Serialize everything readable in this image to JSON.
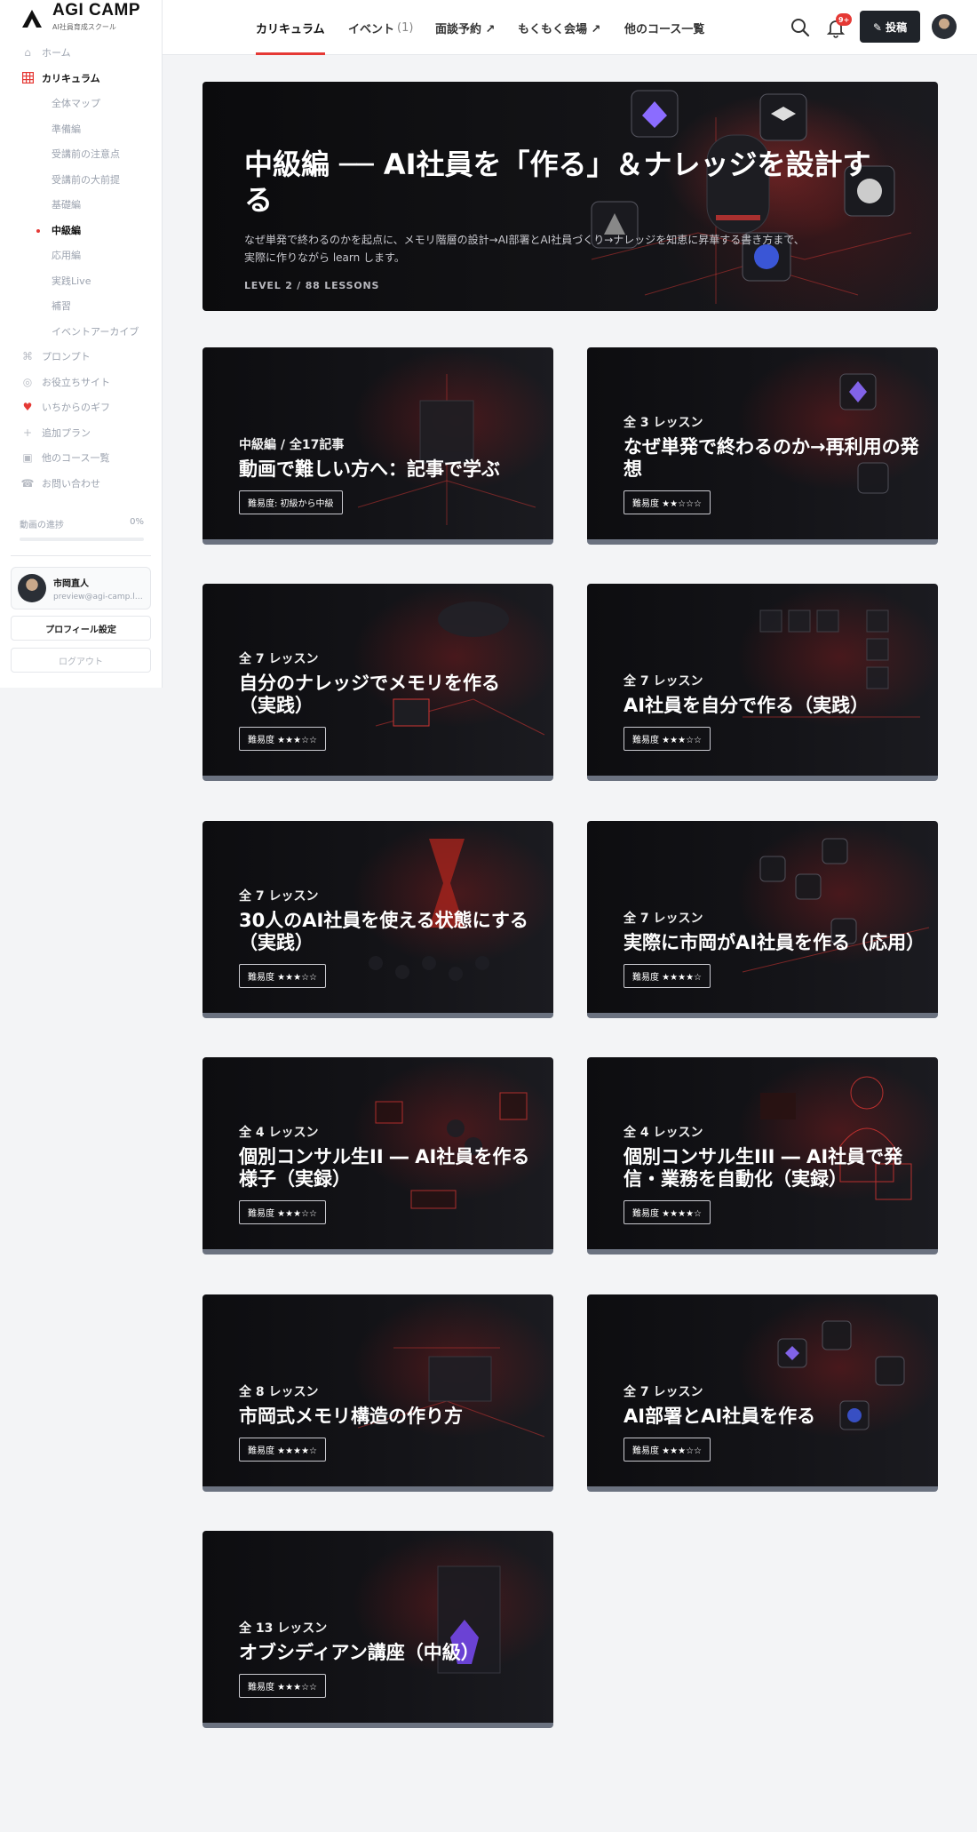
{
  "brand": {
    "title": "AGI CAMP",
    "subtitle": "AI社員育成スクール"
  },
  "sidebar": {
    "items": [
      {
        "label": "ホーム",
        "icon": "home-icon"
      },
      {
        "label": "カリキュラム",
        "icon": "grid-icon",
        "active": true
      },
      {
        "label": "プロンプト",
        "icon": "command-icon"
      },
      {
        "label": "お役立ちサイト",
        "icon": "globe-icon"
      },
      {
        "label": "いちからのギフ",
        "icon": "heart-icon"
      },
      {
        "label": "追加プラン",
        "icon": "plus-icon"
      },
      {
        "label": "他のコース一覧",
        "icon": "folder-icon"
      },
      {
        "label": "お問い合わせ",
        "icon": "phone-icon"
      }
    ],
    "curriculum_sub": [
      "全体マップ",
      "準備編",
      "受講前の注意点",
      "受講前の大前提",
      "基礎編",
      "中級編",
      "応用編",
      "実践Live",
      "補習",
      "イベントアーカイブ"
    ],
    "progress_label": "動画の進捗",
    "progress_value": "0%",
    "profile": {
      "name": "市岡直人",
      "email": "preview@agi-camp.local"
    },
    "profile_button": "プロフィール設定",
    "logout_button": "ログアウト"
  },
  "topbar": {
    "tabs": [
      {
        "label": "カリキュラム",
        "count": ""
      },
      {
        "label": "イベント",
        "count": "(1)"
      },
      {
        "label": "面談予約 ↗",
        "count": ""
      },
      {
        "label": "もくもく会場 ↗",
        "count": ""
      },
      {
        "label": "他のコース一覧",
        "count": ""
      }
    ],
    "badge": "9+",
    "post_label": "✎ 投稿"
  },
  "hero": {
    "title": "中級編 ── AI社員を「作る」＆ナレッジを設計する",
    "description": "なぜ単発で終わるのかを起点に、メモリ階層の設計→AI部署とAI社員づくり→ナレッジを知恵に昇華する書き方まで、実際に作りながら learn します。",
    "level": "LEVEL 2 / 88 LESSONS"
  },
  "cards": [
    {
      "count": "中級編 / 全17記事",
      "title": "動画で難しい方へ：記事で学ぶ",
      "difficulty": "難易度: 初級から中級"
    },
    {
      "count": "全 3 レッスン",
      "title": "なぜ単発で終わるのか→再利用の発想",
      "difficulty": "難易度 ★★☆☆☆"
    },
    {
      "count": "全 7 レッスン",
      "title": "自分のナレッジでメモリを作る（実践）",
      "difficulty": "難易度 ★★★☆☆"
    },
    {
      "count": "全 7 レッスン",
      "title": "AI社員を自分で作る（実践）",
      "difficulty": "難易度 ★★★☆☆"
    },
    {
      "count": "全 7 レッスン",
      "title": "30人のAI社員を使える状態にする（実践）",
      "difficulty": "難易度 ★★★☆☆"
    },
    {
      "count": "全 7 レッスン",
      "title": "実際に市岡がAI社員を作る（応用）",
      "difficulty": "難易度 ★★★★☆"
    },
    {
      "count": "全 4 レッスン",
      "title": "個別コンサル生II ― AI社員を作る様子（実録）",
      "difficulty": "難易度 ★★★☆☆"
    },
    {
      "count": "全 4 レッスン",
      "title": "個別コンサル生III ― AI社員で発信・業務を自動化（実録）",
      "difficulty": "難易度 ★★★★☆"
    },
    {
      "count": "全 8 レッスン",
      "title": "市岡式メモリ構造の作り方",
      "difficulty": "難易度 ★★★★☆"
    },
    {
      "count": "全 7 レッスン",
      "title": "AI部署とAI社員を作る",
      "difficulty": "難易度 ★★★☆☆"
    },
    {
      "count": "全 13 レッスン",
      "title": "オブシディアン講座（中級）",
      "difficulty": "難易度 ★★★☆☆"
    }
  ]
}
